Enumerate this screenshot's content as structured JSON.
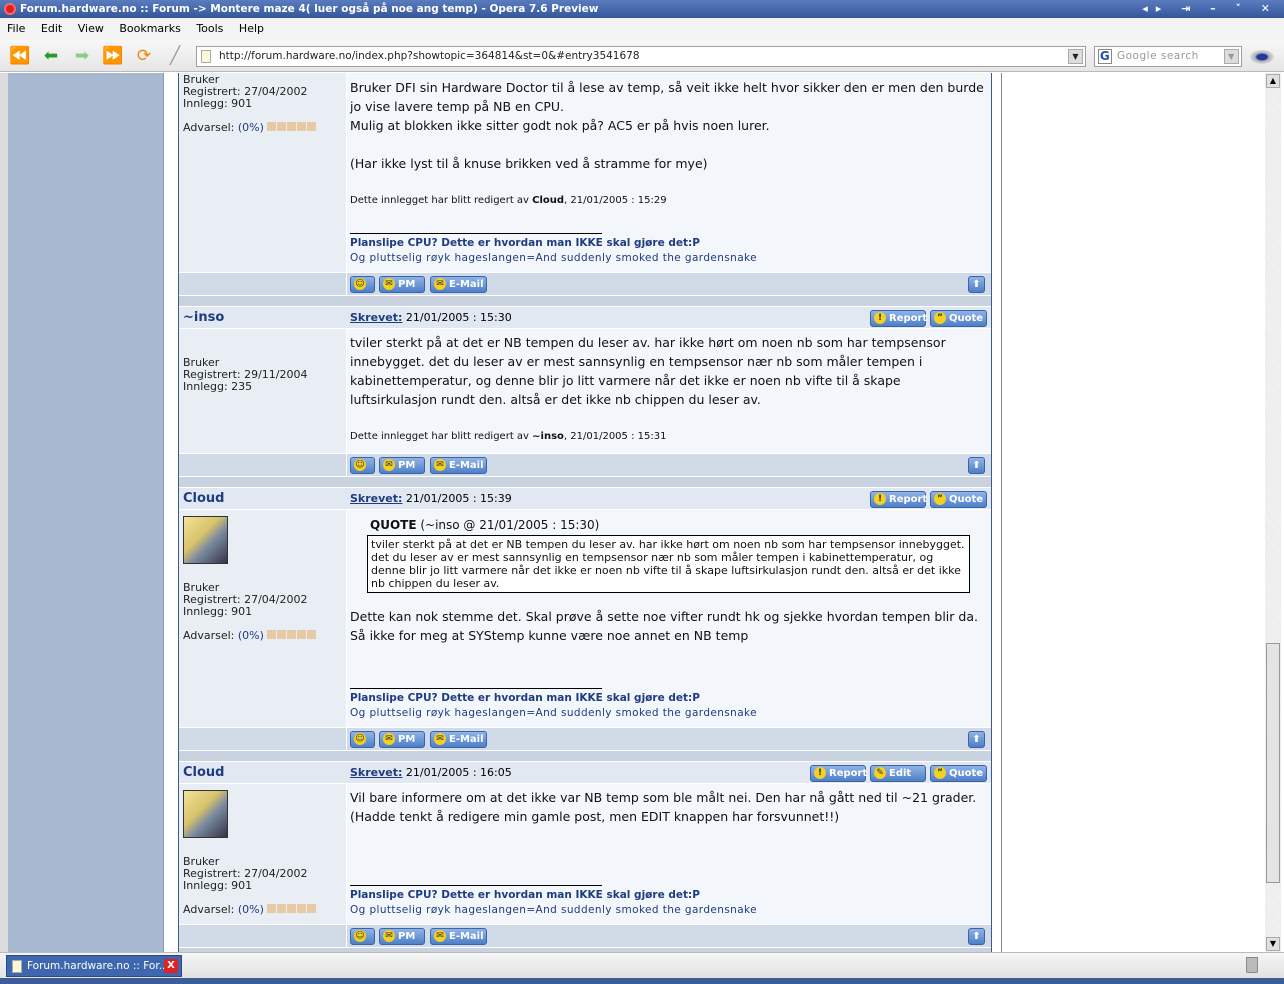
{
  "window": {
    "title": "Forum.hardware.no :: Forum -> Montere maze 4( luer også på noe ang temp) - Opera 7.6 Preview",
    "controls": "◂▸ ⇥ – ˅ ✕"
  },
  "menu": [
    "File",
    "Edit",
    "View",
    "Bookmarks",
    "Tools",
    "Help"
  ],
  "toolbar": {
    "url": "http://forum.hardware.no/index.php?showtopic=364814&st=0&#entry3541678",
    "search_placeholder": "Google search",
    "search_logo": "G"
  },
  "labels": {
    "posted": "Skrevet:",
    "report": "Report",
    "quote": "Quote",
    "edit": "Edit",
    "pm": "PM",
    "email": "E-Mail",
    "warning": "Advarsel:",
    "warning_pct": "(0%)"
  },
  "signature": {
    "line1": "Planslipe CPU? Dette er hvordan man IKKE skal gjøre det:P",
    "line2": "Og pluttselig røyk hageslangen=And suddenly smoked the gardensnake"
  },
  "posts": [
    {
      "author": "",
      "group": "Bruker",
      "registered": "Registrert: 27/04/2002",
      "posts": "Innlegg: 901",
      "warning": true,
      "date": "",
      "text": [
        "Bruker DFI sin Hardware Doctor til å lese av temp, så veit ikke helt hvor sikker den er men den burde jo vise lavere temp på NB en CPU.",
        "Mulig at blokken ikke sitter godt nok på? AC5 er på hvis noen lurer.",
        "",
        "(Har ikke lyst til å knuse brikken ved å stramme for mye)"
      ],
      "edited": {
        "prefix": "Dette innlegget har blitt redigert av ",
        "by": "Cloud",
        "date": ", 21/01/2005 : 15:29"
      },
      "signature": true
    },
    {
      "author": "~inso",
      "group": "Bruker",
      "registered": "Registrert: 29/11/2004",
      "posts": "Innlegg: 235",
      "warning": false,
      "date": "21/01/2005 : 15:30",
      "text": [
        "tviler sterkt på at det er NB tempen du leser av. har ikke hørt om noen nb som har tempsensor innebygget. det du leser av er mest sannsynlig en tempsensor nær nb som måler tempen i kabinettemperatur, og denne blir jo litt varmere når det ikke er noen nb vifte til å skape luftsirkulasjon rundt den. altså er det ikke nb chippen du leser av."
      ],
      "edited": {
        "prefix": "Dette innlegget har blitt redigert av ",
        "by": "~inso",
        "date": ", 21/01/2005 : 15:31"
      },
      "signature": false
    },
    {
      "author": "Cloud",
      "avatar": true,
      "group": "Bruker",
      "registered": "Registrert: 27/04/2002",
      "posts": "Innlegg: 901",
      "warning": true,
      "date": "21/01/2005 : 15:39",
      "quote": {
        "head": "QUOTE",
        "meta": " (~inso @ 21/01/2005 : 15:30)",
        "text": "tviler sterkt på at det er NB tempen du leser av. har ikke hørt om noen nb som har tempsensor innebygget. det du leser av er mest sannsynlig en tempsensor nær nb som måler tempen i kabinettemperatur, og denne blir jo litt varmere når det ikke er noen nb vifte til å skape luftsirkulasjon rundt den. altså er det ikke nb chippen du leser av."
      },
      "text": [
        "Dette kan nok stemme det. Skal prøve å sette noe vifter rundt hk og sjekke hvordan tempen blir da.",
        "Så ikke for meg at SYStemp kunne være noe annet en NB temp"
      ],
      "smiley": true,
      "signature": true
    },
    {
      "author": "Cloud",
      "avatar": true,
      "editable": true,
      "group": "Bruker",
      "registered": "Registrert: 27/04/2002",
      "posts": "Innlegg: 901",
      "warning": true,
      "date": "21/01/2005 : 16:05",
      "text": [
        "Vil bare informere om at det ikke var NB temp som ble målt nei. Den har nå gått ned til ~21 grader.",
        "(Hadde tenkt å redigere min gamle post, men EDIT knappen har forsvunnet!!)"
      ],
      "signature": true
    }
  ],
  "tabbar": {
    "tab_title": "Forum.hardware.no :: For..."
  }
}
